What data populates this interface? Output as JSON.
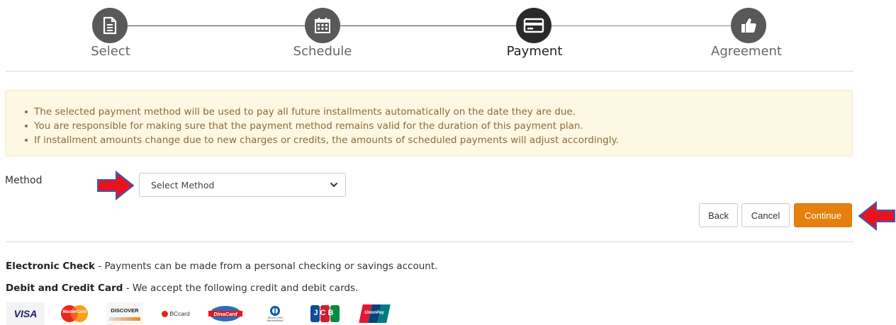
{
  "stepper": {
    "steps": [
      {
        "label": "Select",
        "icon": "document-icon"
      },
      {
        "label": "Schedule",
        "icon": "calendar-icon"
      },
      {
        "label": "Payment",
        "icon": "credit-card-icon",
        "active": true
      },
      {
        "label": "Agreement",
        "icon": "thumbs-up-icon"
      }
    ]
  },
  "notice": {
    "items": [
      "The selected payment method will be used to pay all future installments automatically on the date they are due.",
      "You are responsible for making sure that the payment method remains valid for the duration of this payment plan.",
      "If installment amounts change due to new charges or credits, the amounts of scheduled payments will adjust accordingly."
    ]
  },
  "method": {
    "label": "Method",
    "selected": "Select Method"
  },
  "buttons": {
    "back": "Back",
    "cancel": "Cancel",
    "continue": "Continue"
  },
  "info": {
    "echeck_title": "Electronic Check",
    "echeck_text": " - Payments can be made from a personal checking or savings account.",
    "card_title": "Debit and Credit Card",
    "card_text": " - We accept the following credit and debit cards."
  },
  "cards": {
    "visa": "VISA",
    "mastercard": "MasterCard",
    "discover": "DISCOVER",
    "bccard": "BCcard",
    "dinacard": "DinaCard",
    "diners": "Diners Club International",
    "jcb": "JCB",
    "unionpay": "UnionPay"
  },
  "colors": {
    "accent": "#e5800f",
    "arrow": "#e8141a",
    "notice_bg": "#fcf8e3",
    "notice_text": "#8a6d3b",
    "step_circle": "#595959",
    "step_circle_active": "#2a2a2a"
  }
}
